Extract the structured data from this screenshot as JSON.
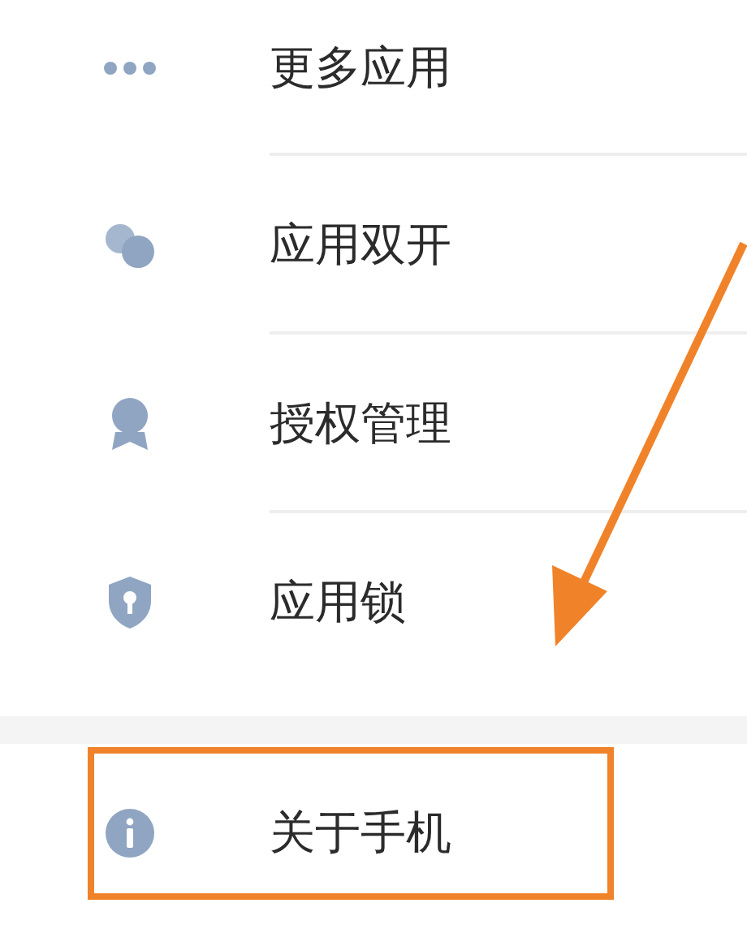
{
  "sections": [
    {
      "items": [
        {
          "kind": "more",
          "label": "更多应用",
          "highlighted": false
        },
        {
          "kind": "dual",
          "label": "应用双开",
          "highlighted": false
        },
        {
          "kind": "badge",
          "label": "授权管理",
          "highlighted": false
        },
        {
          "kind": "lock",
          "label": "应用锁",
          "highlighted": false
        }
      ]
    },
    {
      "items": [
        {
          "kind": "info",
          "label": "关于手机",
          "highlighted": true
        }
      ]
    }
  ],
  "annotation": {
    "arrow": true
  }
}
